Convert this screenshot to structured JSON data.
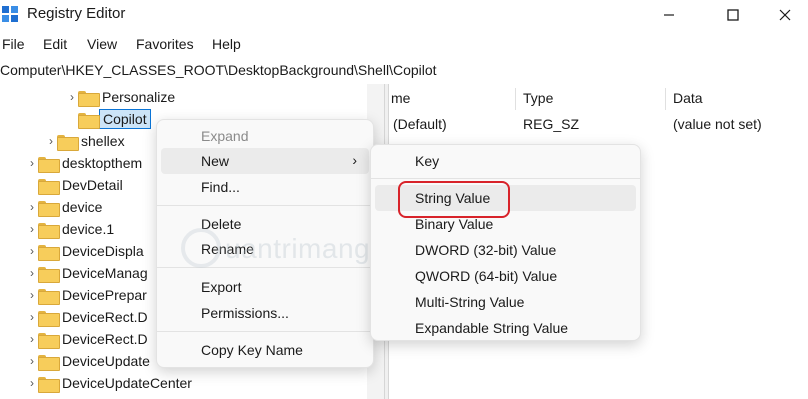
{
  "window": {
    "title": "Registry Editor"
  },
  "menubar": {
    "items": [
      "File",
      "Edit",
      "View",
      "Favorites",
      "Help"
    ]
  },
  "address": {
    "path": "Computer\\HKEY_CLASSES_ROOT\\DesktopBackground\\Shell\\Copilot"
  },
  "tree": {
    "items": [
      {
        "label": "Personalize",
        "expandable": true
      },
      {
        "label": "Copilot",
        "expandable": false,
        "selected": true
      },
      {
        "label": "shellex",
        "expandable": true
      },
      {
        "label": "desktopthem",
        "expandable": true
      },
      {
        "label": "DevDetail",
        "expandable": false
      },
      {
        "label": "device",
        "expandable": true
      },
      {
        "label": "device.1",
        "expandable": true
      },
      {
        "label": "DeviceDispla",
        "expandable": true
      },
      {
        "label": "DeviceManag",
        "expandable": true
      },
      {
        "label": "DevicePrepar",
        "expandable": true
      },
      {
        "label": "DeviceRect.D",
        "expandable": true
      },
      {
        "label": "DeviceRect.D",
        "expandable": true
      },
      {
        "label": "DeviceUpdate",
        "expandable": true
      },
      {
        "label": "DeviceUpdateCenter",
        "expandable": true
      }
    ]
  },
  "values_pane": {
    "columns": {
      "name": "me",
      "type": "Type",
      "data": "Data"
    },
    "rows": [
      {
        "name": "(Default)",
        "type": "REG_SZ",
        "data": "(value not set)"
      }
    ]
  },
  "context_menu": {
    "expand": "Expand",
    "new": "New",
    "find": "Find...",
    "delete": "Delete",
    "rename": "Rename",
    "export": "Export",
    "permissions": "Permissions...",
    "copy_key_name": "Copy Key Name"
  },
  "submenu": {
    "key": "Key",
    "string_value": "String Value",
    "binary_value": "Binary Value",
    "dword": "DWORD (32-bit) Value",
    "qword": "QWORD (64-bit) Value",
    "multi_string": "Multi-String Value",
    "expandable_string": "Expandable String Value"
  },
  "watermark": {
    "text": "uantrimang"
  },
  "colors": {
    "selection": "#cce4f7",
    "highlight_ring": "#d8232a",
    "folder": "#f7cd5b"
  }
}
